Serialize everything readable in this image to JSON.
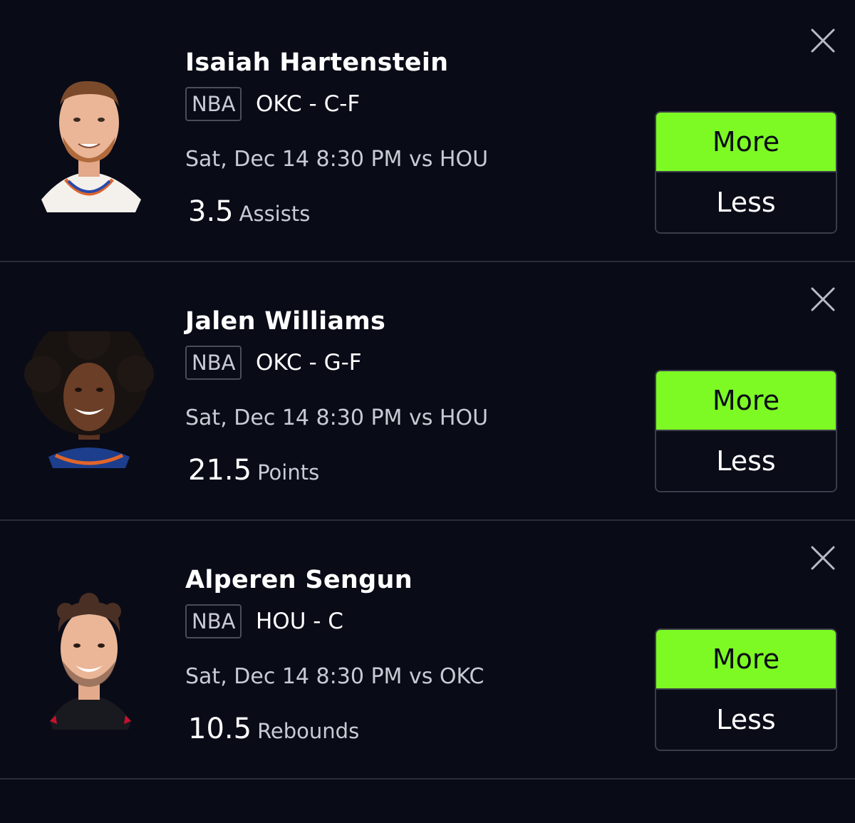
{
  "picks": [
    {
      "player_name": "Isaiah Hartenstein",
      "league": "NBA",
      "team_position": "OKC - C-F",
      "game": "Sat, Dec 14 8:30 PM vs HOU",
      "line_value": "3.5",
      "stat": "Assists",
      "more_label": "More",
      "less_label": "Less"
    },
    {
      "player_name": "Jalen Williams",
      "league": "NBA",
      "team_position": "OKC - G-F",
      "game": "Sat, Dec 14 8:30 PM vs HOU",
      "line_value": "21.5",
      "stat": "Points",
      "more_label": "More",
      "less_label": "Less"
    },
    {
      "player_name": "Alperen Sengun",
      "league": "NBA",
      "team_position": "HOU - C",
      "game": "Sat, Dec 14 8:30 PM vs OKC",
      "line_value": "10.5",
      "stat": "Rebounds",
      "more_label": "More",
      "less_label": "Less"
    }
  ],
  "icons": {
    "remove": "close-icon",
    "avatar": "player-headshot"
  },
  "colors": {
    "background": "#090b17",
    "more_accent": "#7dfa24",
    "divider": "#2a2d3a"
  }
}
